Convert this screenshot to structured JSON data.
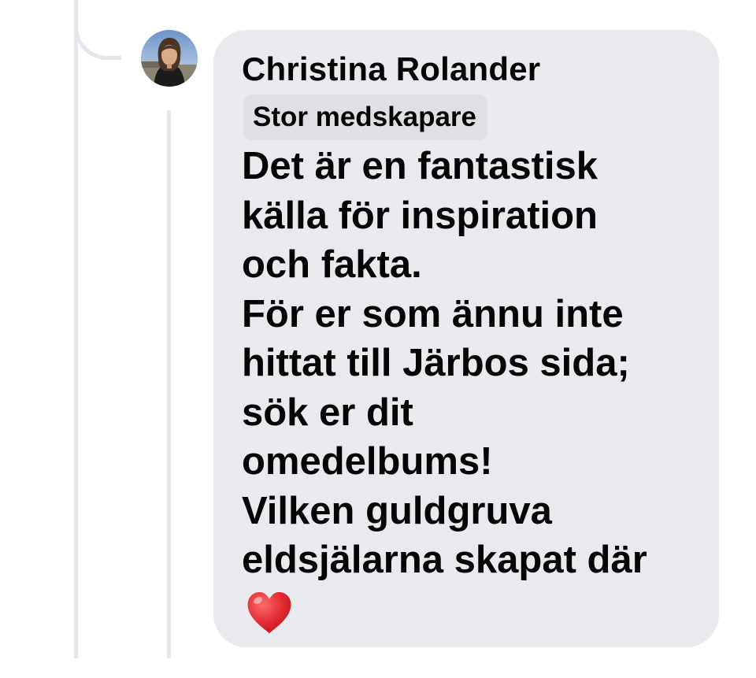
{
  "comment": {
    "author_name": "Christina Rolander",
    "author_badge": "Stor medskapare",
    "text_lines": [
      "Det är en fantastisk",
      "källa för inspiration",
      "och fakta.",
      "För er som ännu inte",
      "hittat till Järbos sida;",
      "sök er dit",
      "omedelbums!",
      "Vilken guldgruva",
      "eldsjälarna skapat där"
    ],
    "emoji": "heart-emoji",
    "colors": {
      "bubble_background": "#e9eaee",
      "badge_background": "#dfe0e4",
      "text": "#050505",
      "thread_line": "#e4e6eb",
      "heart": "#e0282e"
    }
  }
}
